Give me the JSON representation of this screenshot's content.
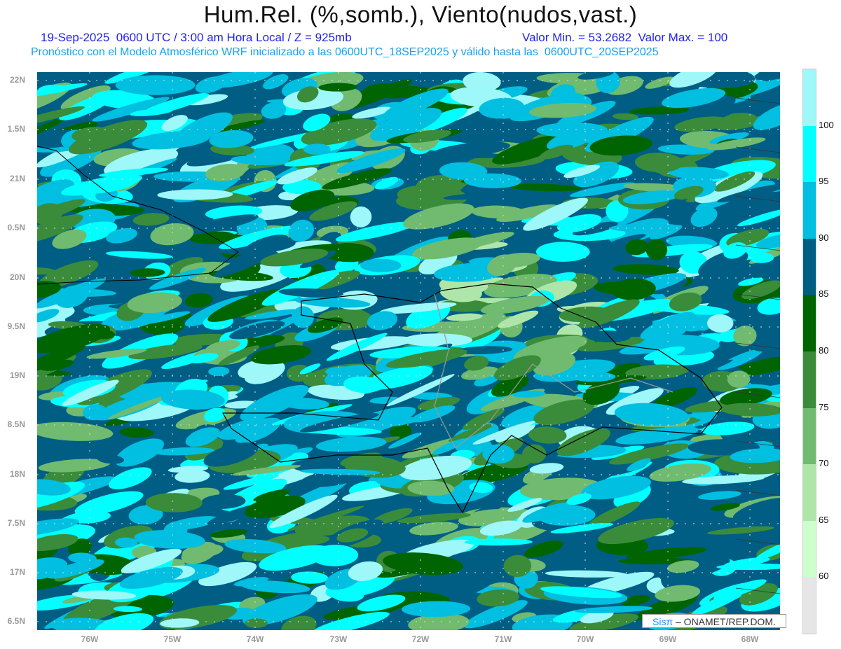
{
  "header": {
    "title": "Hum.Rel. (%,somb.), Viento(nudos,vast.)",
    "subtitle_left": "19-Sep-2025  0600 UTC / 3:00 am Hora Local / Z = 925mb",
    "subtitle_right": "Valor Min. = 53.2682  Valor Max. = 100",
    "subtitle_model": "Pronóstico con el Modelo Atmosférico WRF inicializado a las 0600UTC_18SEP2025 y válido hasta las  0600UTC_20SEP2025"
  },
  "axes": {
    "lat_labels": [
      "22N",
      "1.5N",
      "21N",
      "0.5N",
      "20N",
      "9.5N",
      "19N",
      "8.5N",
      "18N",
      "7.5N",
      "17N",
      "6.5N"
    ],
    "lon_labels": [
      "76W",
      "75W",
      "74W",
      "73W",
      "72W",
      "71W",
      "70W",
      "69W",
      "68W"
    ]
  },
  "colorbar": {
    "labels": [
      "100",
      "95",
      "90",
      "85",
      "80",
      "75",
      "70",
      "65",
      "60"
    ],
    "colors": [
      "#9ef7f8",
      "#00ffff",
      "#00bfe0",
      "#005e85",
      "#006400",
      "#3a8c3a",
      "#70bb70",
      "#aee6aa",
      "#ccffcc",
      "#e6e6e6"
    ]
  },
  "credit": {
    "logo": "Sisπ",
    "org": "– ONAMET/REP.DOM."
  }
}
